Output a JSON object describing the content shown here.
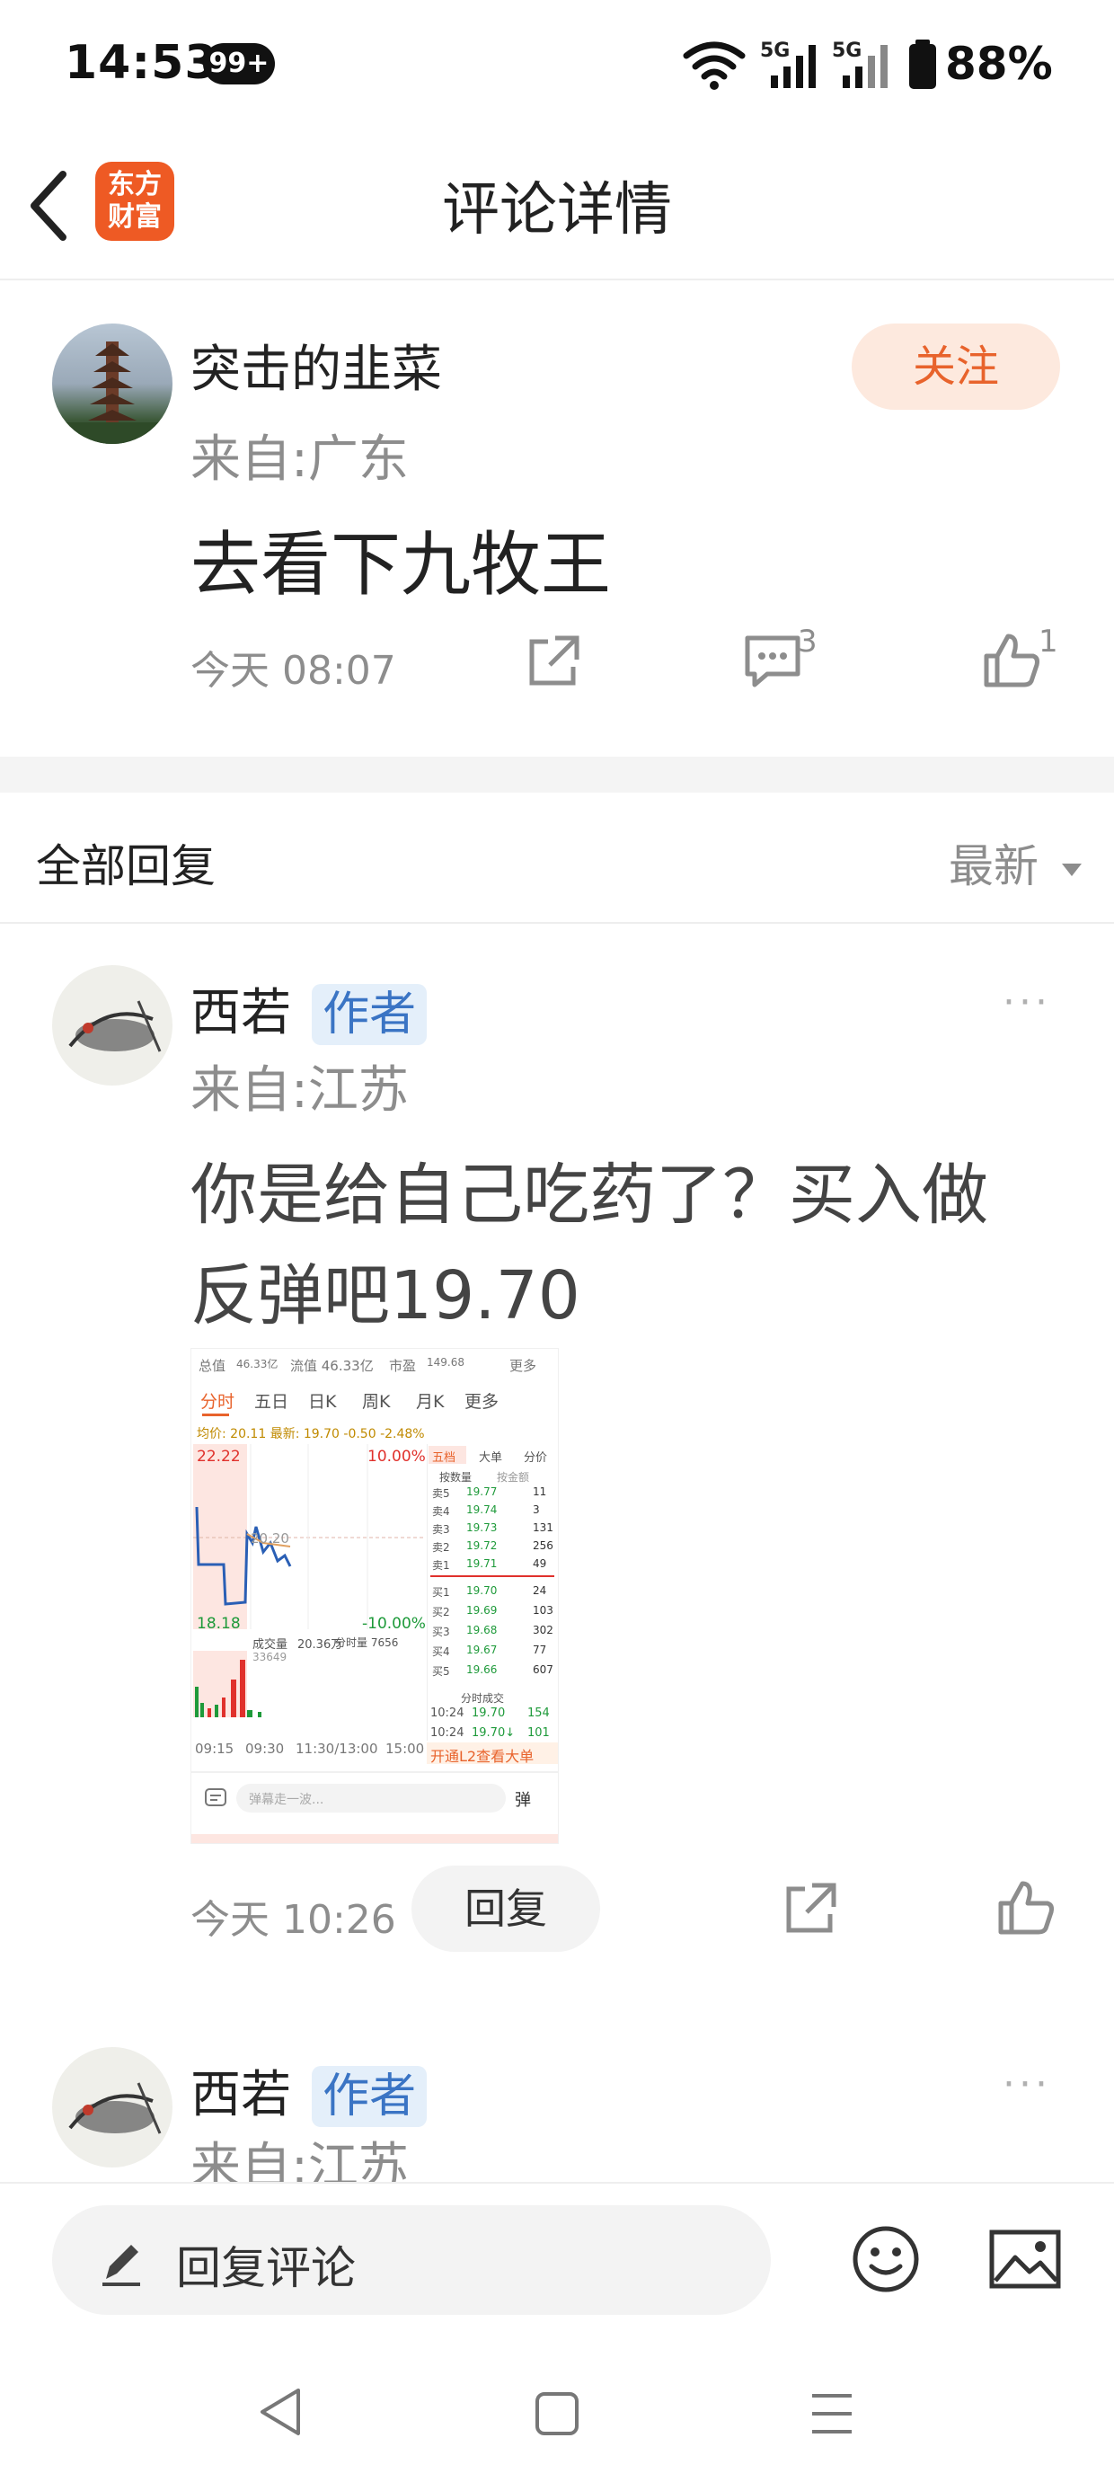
{
  "status_bar": {
    "time": "14:53",
    "badge": "99+",
    "network1": "5G",
    "network2": "5G",
    "battery": "88%"
  },
  "header": {
    "title": "评论详情",
    "logo_line1": "东方",
    "logo_line2": "财富",
    "back_icon": "chevron-left-icon"
  },
  "post": {
    "user": "突击的韭菜",
    "location": "来自:广东",
    "follow_label": "关注",
    "content": "去看下九牧王",
    "time": "今天 08:07",
    "comment_count": "3",
    "like_count": "1"
  },
  "replies_header": {
    "title": "全部回复",
    "sort": "最新"
  },
  "replies": [
    {
      "user": "西若",
      "tag": "作者",
      "location": "来自:江苏",
      "content_line1": "你是给自己吃药了？买入做",
      "content_line2": "反弹吧19.70",
      "time": "今天 10:26",
      "reply_label": "回复",
      "more": "···"
    },
    {
      "user": "西若",
      "tag": "作者",
      "location": "来自:江苏",
      "more": "···"
    }
  ],
  "thumbnail": {
    "top_row": [
      "总值",
      "46.33亿",
      "流值 46.33亿",
      "市盈",
      "149.68",
      "更多"
    ],
    "tabs": [
      "分时",
      "五日",
      "日K",
      "周K",
      "月K",
      "更多"
    ],
    "price_line": "均价: 20.11 最新: 19.70 -0.50 -2.48%",
    "high": "22.22",
    "high_pct": "10.00%",
    "mid": "20.20",
    "low": "18.18",
    "low_pct": "-10.00%",
    "vol_label": "成交量",
    "vol_value": "20.36万",
    "vol_extra": "分时量 7656",
    "vol_count": "33649",
    "times": [
      "09:15",
      "09:30",
      "11:30/13:00",
      "15:00"
    ],
    "book_tabs": [
      "五档",
      "大单",
      "分价"
    ],
    "book_headers": [
      "按数量",
      "按金额"
    ],
    "asks": [
      {
        "label": "卖5",
        "price": "19.77",
        "qty": "11"
      },
      {
        "label": "卖4",
        "price": "19.74",
        "qty": "3"
      },
      {
        "label": "卖3",
        "price": "19.73",
        "qty": "131"
      },
      {
        "label": "卖2",
        "price": "19.72",
        "qty": "256"
      },
      {
        "label": "卖1",
        "price": "19.71",
        "qty": "49"
      }
    ],
    "bids": [
      {
        "label": "买1",
        "price": "19.70",
        "qty": "24"
      },
      {
        "label": "买2",
        "price": "19.69",
        "qty": "103"
      },
      {
        "label": "买3",
        "price": "19.68",
        "qty": "302"
      },
      {
        "label": "买4",
        "price": "19.67",
        "qty": "77"
      },
      {
        "label": "买5",
        "price": "19.66",
        "qty": "607"
      }
    ],
    "tick_header": "分时成交",
    "ticks": [
      {
        "time": "10:24",
        "price": "19.70",
        "qty": "154"
      },
      {
        "time": "10:24",
        "price": "19.70↓",
        "qty": "101"
      }
    ],
    "l2_banner": "开通L2查看大单",
    "danmaku_placeholder": "弹幕走一波...",
    "danmaku_btn": "弹"
  },
  "bottom_bar": {
    "reply_placeholder": "回复评论"
  },
  "colors": {
    "accent_orange": "#e8632c",
    "follow_bg": "#fde9de",
    "author_tag_bg": "#e4effa",
    "author_tag_text": "#3a74c4",
    "rise_red": "#e0312c",
    "fall_green": "#1e9a3a"
  }
}
